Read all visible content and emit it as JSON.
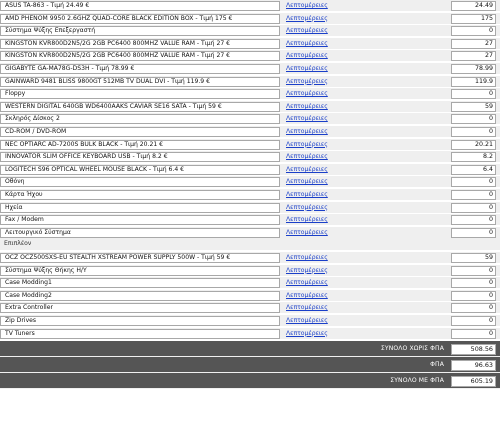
{
  "link_label": "Λεπτομέρειες",
  "rows": [
    {
      "name": "ASUS TA-863 - Τιμή 24.49 €",
      "value": "24.49"
    },
    {
      "name": "AMD PHENOM 9950 2.6GHZ QUAD-CORE BLACK EDITION BOX - Τιμή 175 €",
      "value": "175"
    },
    {
      "name": "Σύστημα Ψύξης Επεξεργαστή",
      "value": "0"
    },
    {
      "name": "KINGSTON KVR800D2N5/2G 2GB PC6400 800MHZ VALUE RAM - Τιμή 27 €",
      "value": "27"
    },
    {
      "name": "KINGSTON KVR800D2N5/2G 2GB PC6400 800MHZ VALUE RAM - Τιμή 27 €",
      "value": "27"
    },
    {
      "name": "GIGABYTE GA-MA78G-DS3H - Τιμή 78.99 €",
      "value": "78.99"
    },
    {
      "name": "GAINWARD 9481 BLISS 9800GT 512MB TV DUAL DVI - Τιμή 119.9 €",
      "value": "119.9"
    },
    {
      "name": "Floppy",
      "value": "0"
    },
    {
      "name": "WESTERN DIGITAL 640GB WD6400AAKS CAVIAR SE16 SATA - Τιμή 59 €",
      "value": "59"
    },
    {
      "name": "Σκληρός Δίσκος 2",
      "value": "0"
    },
    {
      "name": "CD-ROM / DVD-ROM",
      "value": "0"
    },
    {
      "name": "NEC OPTIARC AD-7200S BULK BLACK - Τιμή 20.21 €",
      "value": "20.21"
    },
    {
      "name": "INNOVATOR SLIM OFFICE KEYBOARD USB - Τιμή 8.2 €",
      "value": "8.2"
    },
    {
      "name": "LOGITECH S96 OPTICAL WHEEL MOUSE BLACK - Τιμή 6.4 €",
      "value": "6.4"
    },
    {
      "name": "Οθόνη",
      "value": "0"
    },
    {
      "name": "Κάρτα Ήχου",
      "value": "0"
    },
    {
      "name": "Ηχεία",
      "value": "0"
    },
    {
      "name": "Fax / Modem",
      "value": "0"
    },
    {
      "name": "Λειτουργικό Σύστημα",
      "value": "0"
    }
  ],
  "section_label": "Επιπλέον",
  "extra_rows": [
    {
      "name": "OCZ OCZ500SXS-EU STEALTH XSTREAM POWER SUPPLY 500W - Τιμή 59 €",
      "value": "59"
    },
    {
      "name": "Σύστημα Ψύξης Θήκης Η/Υ",
      "value": "0"
    },
    {
      "name": "Case Modding1",
      "value": "0"
    },
    {
      "name": "Case Modding2",
      "value": "0"
    },
    {
      "name": "Extra Controller",
      "value": "0"
    },
    {
      "name": "Zip Drives",
      "value": "0"
    },
    {
      "name": "TV Tuners",
      "value": "0"
    }
  ],
  "totals": [
    {
      "label": "ΣΥΝΟΛΟ ΧΩΡΙΣ ΦΠΑ",
      "value": "508.56"
    },
    {
      "label": "ΦΠΑ",
      "value": "96.63"
    },
    {
      "label": "ΣΥΝΟΛΟ ΜΕ ΦΠΑ",
      "value": "605.19"
    }
  ]
}
